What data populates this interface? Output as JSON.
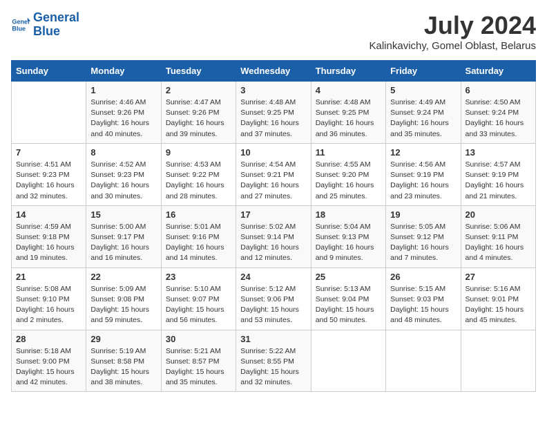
{
  "header": {
    "logo_line1": "General",
    "logo_line2": "Blue",
    "title": "July 2024",
    "subtitle": "Kalinkavichy, Gomel Oblast, Belarus"
  },
  "days_of_week": [
    "Sunday",
    "Monday",
    "Tuesday",
    "Wednesday",
    "Thursday",
    "Friday",
    "Saturday"
  ],
  "weeks": [
    [
      {
        "day": "",
        "info": ""
      },
      {
        "day": "1",
        "info": "Sunrise: 4:46 AM\nSunset: 9:26 PM\nDaylight: 16 hours\nand 40 minutes."
      },
      {
        "day": "2",
        "info": "Sunrise: 4:47 AM\nSunset: 9:26 PM\nDaylight: 16 hours\nand 39 minutes."
      },
      {
        "day": "3",
        "info": "Sunrise: 4:48 AM\nSunset: 9:25 PM\nDaylight: 16 hours\nand 37 minutes."
      },
      {
        "day": "4",
        "info": "Sunrise: 4:48 AM\nSunset: 9:25 PM\nDaylight: 16 hours\nand 36 minutes."
      },
      {
        "day": "5",
        "info": "Sunrise: 4:49 AM\nSunset: 9:24 PM\nDaylight: 16 hours\nand 35 minutes."
      },
      {
        "day": "6",
        "info": "Sunrise: 4:50 AM\nSunset: 9:24 PM\nDaylight: 16 hours\nand 33 minutes."
      }
    ],
    [
      {
        "day": "7",
        "info": "Sunrise: 4:51 AM\nSunset: 9:23 PM\nDaylight: 16 hours\nand 32 minutes."
      },
      {
        "day": "8",
        "info": "Sunrise: 4:52 AM\nSunset: 9:23 PM\nDaylight: 16 hours\nand 30 minutes."
      },
      {
        "day": "9",
        "info": "Sunrise: 4:53 AM\nSunset: 9:22 PM\nDaylight: 16 hours\nand 28 minutes."
      },
      {
        "day": "10",
        "info": "Sunrise: 4:54 AM\nSunset: 9:21 PM\nDaylight: 16 hours\nand 27 minutes."
      },
      {
        "day": "11",
        "info": "Sunrise: 4:55 AM\nSunset: 9:20 PM\nDaylight: 16 hours\nand 25 minutes."
      },
      {
        "day": "12",
        "info": "Sunrise: 4:56 AM\nSunset: 9:19 PM\nDaylight: 16 hours\nand 23 minutes."
      },
      {
        "day": "13",
        "info": "Sunrise: 4:57 AM\nSunset: 9:19 PM\nDaylight: 16 hours\nand 21 minutes."
      }
    ],
    [
      {
        "day": "14",
        "info": "Sunrise: 4:59 AM\nSunset: 9:18 PM\nDaylight: 16 hours\nand 19 minutes."
      },
      {
        "day": "15",
        "info": "Sunrise: 5:00 AM\nSunset: 9:17 PM\nDaylight: 16 hours\nand 16 minutes."
      },
      {
        "day": "16",
        "info": "Sunrise: 5:01 AM\nSunset: 9:16 PM\nDaylight: 16 hours\nand 14 minutes."
      },
      {
        "day": "17",
        "info": "Sunrise: 5:02 AM\nSunset: 9:14 PM\nDaylight: 16 hours\nand 12 minutes."
      },
      {
        "day": "18",
        "info": "Sunrise: 5:04 AM\nSunset: 9:13 PM\nDaylight: 16 hours\nand 9 minutes."
      },
      {
        "day": "19",
        "info": "Sunrise: 5:05 AM\nSunset: 9:12 PM\nDaylight: 16 hours\nand 7 minutes."
      },
      {
        "day": "20",
        "info": "Sunrise: 5:06 AM\nSunset: 9:11 PM\nDaylight: 16 hours\nand 4 minutes."
      }
    ],
    [
      {
        "day": "21",
        "info": "Sunrise: 5:08 AM\nSunset: 9:10 PM\nDaylight: 16 hours\nand 2 minutes."
      },
      {
        "day": "22",
        "info": "Sunrise: 5:09 AM\nSunset: 9:08 PM\nDaylight: 15 hours\nand 59 minutes."
      },
      {
        "day": "23",
        "info": "Sunrise: 5:10 AM\nSunset: 9:07 PM\nDaylight: 15 hours\nand 56 minutes."
      },
      {
        "day": "24",
        "info": "Sunrise: 5:12 AM\nSunset: 9:06 PM\nDaylight: 15 hours\nand 53 minutes."
      },
      {
        "day": "25",
        "info": "Sunrise: 5:13 AM\nSunset: 9:04 PM\nDaylight: 15 hours\nand 50 minutes."
      },
      {
        "day": "26",
        "info": "Sunrise: 5:15 AM\nSunset: 9:03 PM\nDaylight: 15 hours\nand 48 minutes."
      },
      {
        "day": "27",
        "info": "Sunrise: 5:16 AM\nSunset: 9:01 PM\nDaylight: 15 hours\nand 45 minutes."
      }
    ],
    [
      {
        "day": "28",
        "info": "Sunrise: 5:18 AM\nSunset: 9:00 PM\nDaylight: 15 hours\nand 42 minutes."
      },
      {
        "day": "29",
        "info": "Sunrise: 5:19 AM\nSunset: 8:58 PM\nDaylight: 15 hours\nand 38 minutes."
      },
      {
        "day": "30",
        "info": "Sunrise: 5:21 AM\nSunset: 8:57 PM\nDaylight: 15 hours\nand 35 minutes."
      },
      {
        "day": "31",
        "info": "Sunrise: 5:22 AM\nSunset: 8:55 PM\nDaylight: 15 hours\nand 32 minutes."
      },
      {
        "day": "",
        "info": ""
      },
      {
        "day": "",
        "info": ""
      },
      {
        "day": "",
        "info": ""
      }
    ]
  ]
}
